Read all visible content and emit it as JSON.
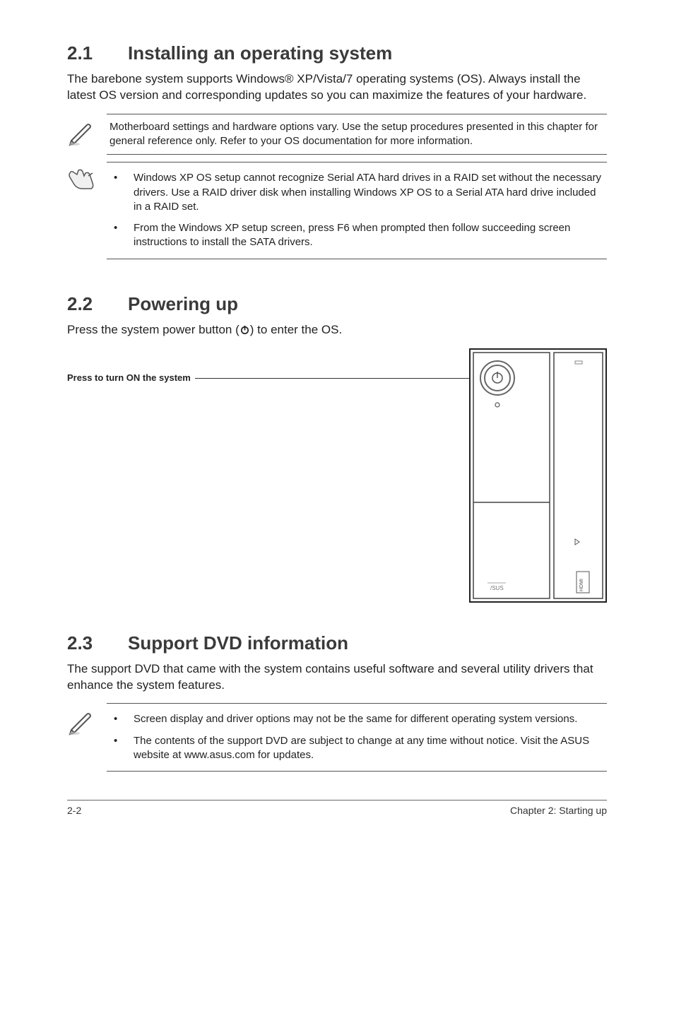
{
  "sections": {
    "install": {
      "num": "2.1",
      "title": "Installing an operating system",
      "body": "The barebone system supports Windows® XP/Vista/7 operating systems (OS). Always install the latest OS version and corresponding updates so you can maximize the features of your hardware.",
      "note1": "Motherboard settings and hardware options vary. Use the setup procedures presented in this chapter for general reference only. Refer to your OS documentation for more information.",
      "note2a": "Windows XP OS setup cannot recognize Serial ATA hard drives in a RAID set without the necessary drivers. Use a RAID driver disk when installing Windows XP OS to a Serial ATA hard drive included in a RAID set.",
      "note2b": "From the Windows XP setup screen, press F6 when prompted then follow succeeding screen instructions to install the SATA drivers."
    },
    "power": {
      "num": "2.2",
      "title": "Powering up",
      "body_pre": "Press the system power button (",
      "body_post": ") to enter the OS.",
      "label": "Press to turn ON the system"
    },
    "dvd": {
      "num": "2.3",
      "title": "Support DVD information",
      "body": "The support DVD that came with the system contains useful software and several utility drivers that enhance the system features.",
      "note1": "Screen display and driver options may not be the same for different operating system versions.",
      "note2": "The contents of the support DVD are subject to change at any time without notice. Visit the ASUS website at www.asus.com for updates."
    }
  },
  "footer": {
    "left": "2-2",
    "right": "Chapter 2: Starting up"
  }
}
